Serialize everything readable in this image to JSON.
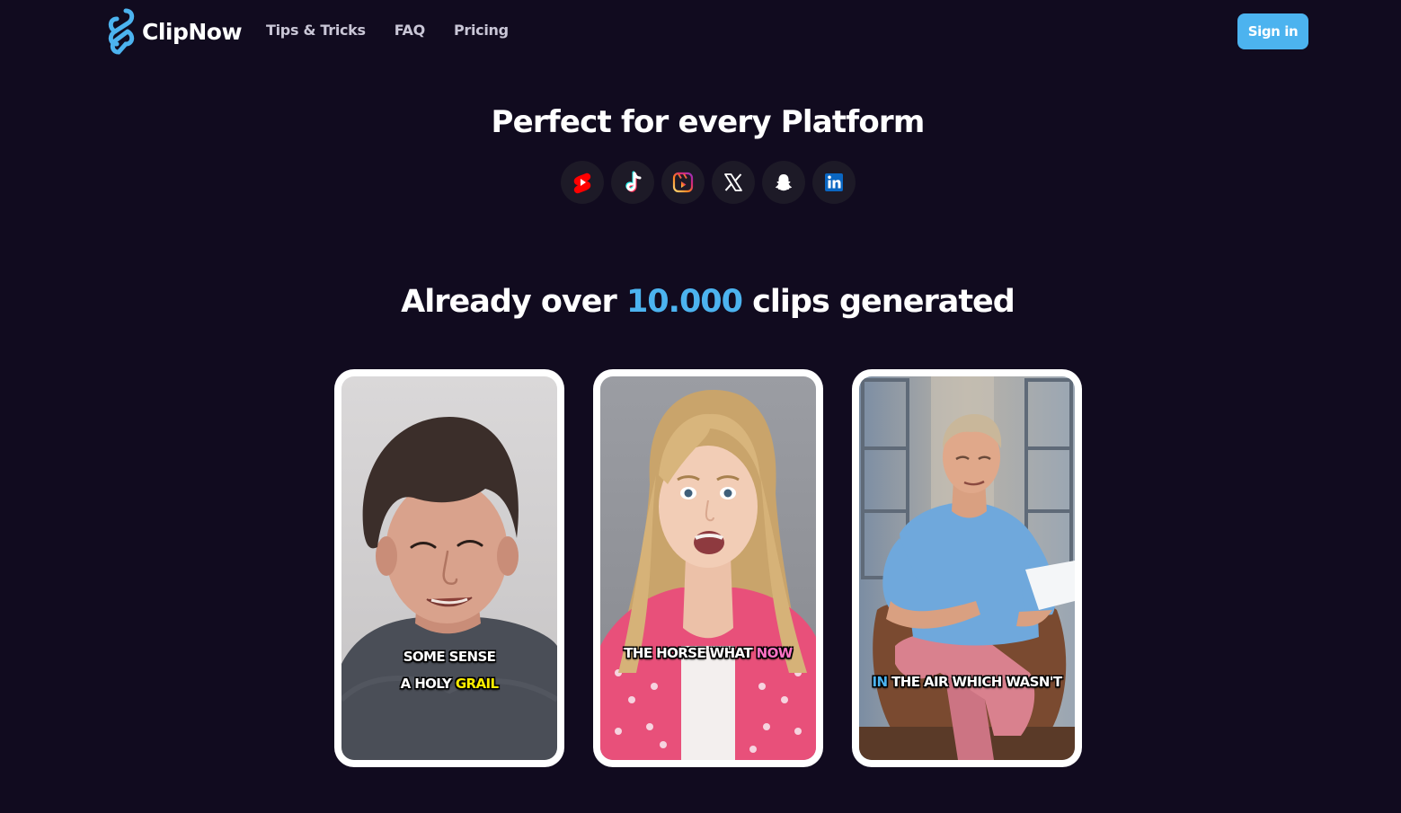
{
  "header": {
    "logo_text": "ClipNow",
    "nav": [
      "Tips & Tricks",
      "FAQ",
      "Pricing"
    ],
    "signin_label": "Sign in"
  },
  "platforms": {
    "title": "Perfect for every Platform",
    "icons": [
      "youtube-shorts-icon",
      "tiktok-icon",
      "instagram-reels-icon",
      "x-icon",
      "snapchat-icon",
      "linkedin-icon"
    ]
  },
  "clips": {
    "title_prefix": "Already over ",
    "title_count": "10.000",
    "title_suffix": " clips generated",
    "cards": [
      {
        "line1": "SOME SENSE",
        "line2_prefix": "A HOLY ",
        "line2_highlight": "GRAIL"
      },
      {
        "line1_prefix": "THE HORSE WHAT ",
        "line1_highlight": "NOW"
      },
      {
        "line1_highlight": "IN",
        "line1_suffix": " THE AIR WHICH WASN'T"
      }
    ]
  },
  "colors": {
    "background": "#110b1f",
    "accent": "#4cb3ef",
    "caption_yellow": "#ffee00",
    "caption_pink": "#ff73c6"
  }
}
